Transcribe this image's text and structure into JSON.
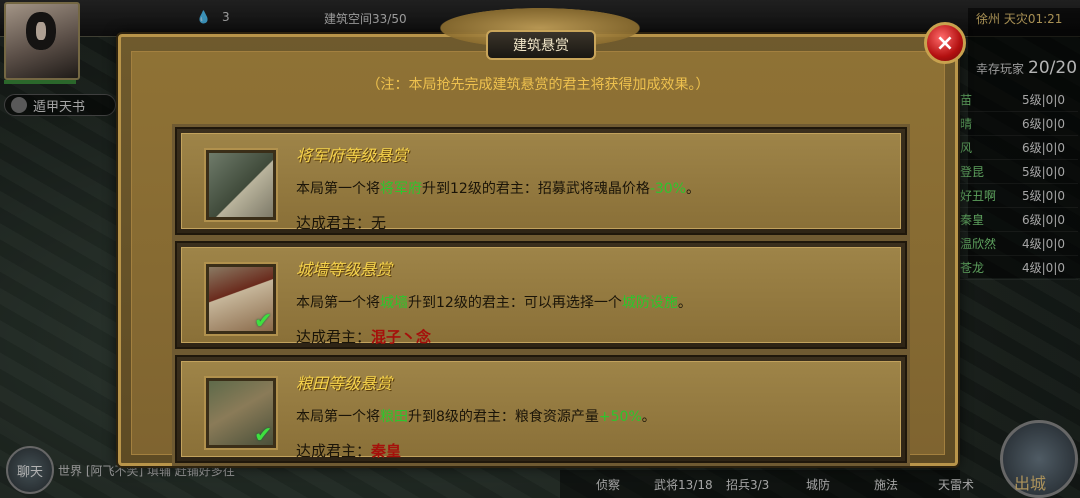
{
  "hud": {
    "resource_count": "3",
    "build_space": "建筑空间33/50",
    "skill_chip": "遁甲天书",
    "city": "徐州",
    "disaster": "天灾01:21",
    "survivors_label": "幸存玩家",
    "survivors": "20/20",
    "players": [
      {
        "name": "苗",
        "level": "5级|0|0"
      },
      {
        "name": "晴",
        "level": "6级|0|0"
      },
      {
        "name": "风",
        "level": "6级|0|0"
      },
      {
        "name": "登昆",
        "level": "5级|0|0"
      },
      {
        "name": "好丑啊",
        "level": "5级|0|0"
      },
      {
        "name": "秦皇",
        "level": "6级|0|0"
      },
      {
        "name": "温欣然",
        "level": "4级|0|0"
      },
      {
        "name": "苍龙",
        "level": "4级|0|0"
      }
    ],
    "chat_button": "聊天",
    "chat_line": "世界 [阿飞不笑] 填辅 赶铺好多往",
    "bottom": [
      "侦察",
      "武将13/18",
      "招兵3/3",
      "城防",
      "施法",
      "天雷术"
    ],
    "exit_label": "出城"
  },
  "modal": {
    "title": "建筑悬赏",
    "close_label": "×",
    "note": "（注：本局抢先完成建筑悬赏的君主将获得加成效果。）",
    "cards": [
      {
        "title": "将军府等级悬赏",
        "desc_pre": "本局第一个将",
        "building": "将军府",
        "desc_mid": "升到12级的君主：招募武将魂晶价格",
        "bonus": "-30%",
        "desc_end": "。",
        "owner_label": "达成君主：",
        "owner": "无",
        "achieved": false
      },
      {
        "title": "城墙等级悬赏",
        "desc_pre": "本局第一个将",
        "building": "城墙",
        "desc_mid": "升到12级的君主：可以再选择一个",
        "bonus": "城防设施",
        "desc_end": "。",
        "owner_label": "达成君主：",
        "owner": "混子丶念",
        "achieved": true
      },
      {
        "title": "粮田等级悬赏",
        "desc_pre": "本局第一个将",
        "building": "粮田",
        "desc_mid": "升到8级的君主：粮食资源产量",
        "bonus": "+50%",
        "desc_end": "。",
        "owner_label": "达成君主：",
        "owner": "秦皇",
        "achieved": true
      }
    ]
  },
  "colors": {
    "accent_gold": "#f5d24a",
    "highlight_green": "#2dc52d",
    "winner_red": "#a5100b",
    "note_color": "#eec14e"
  }
}
